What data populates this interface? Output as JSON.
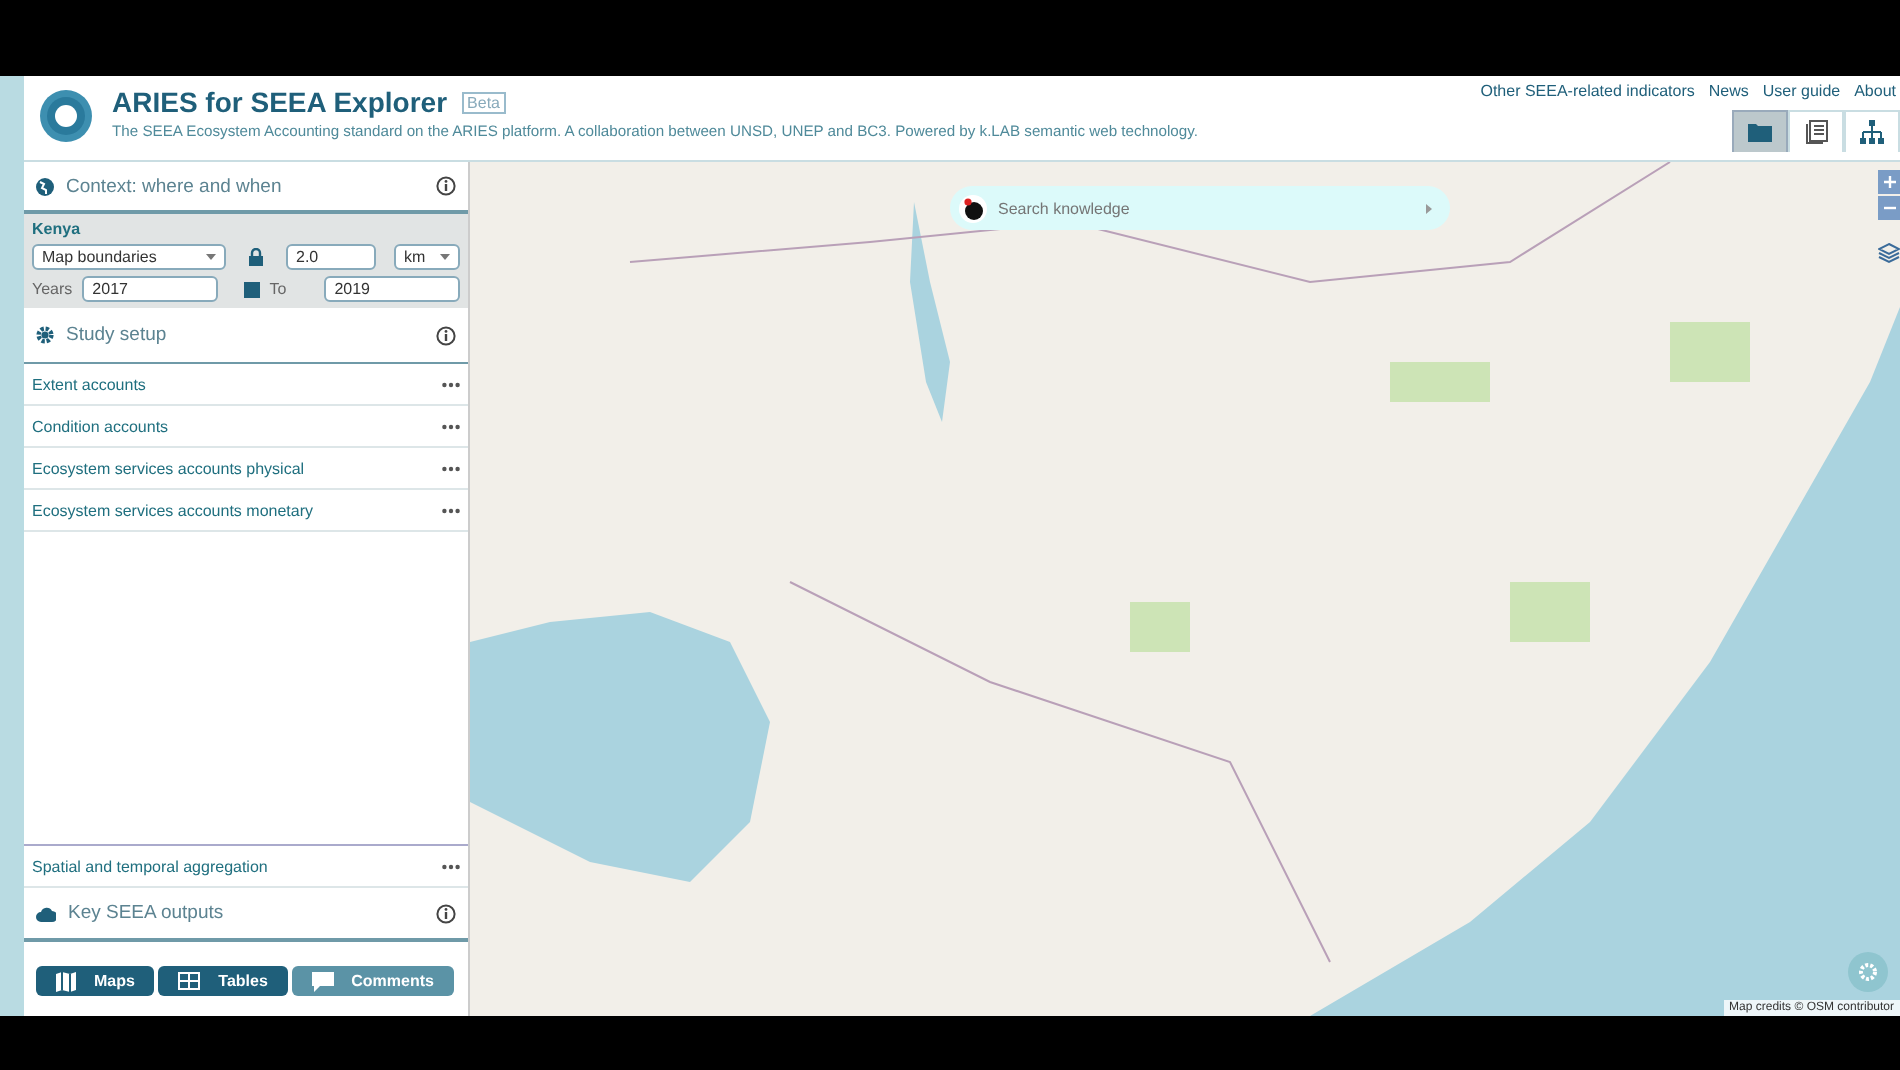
{
  "header": {
    "title": "ARIES for SEEA Explorer",
    "badge": "Beta",
    "subtitle": "The SEEA Ecosystem Accounting standard on the ARIES platform. A collaboration between UNSD, UNEP and BC3. Powered by k.LAB semantic web technology.",
    "links": [
      "Other SEEA-related indicators",
      "News",
      "User guide",
      "About"
    ],
    "view_tabs": [
      {
        "kind": "folder",
        "selected": true
      },
      {
        "kind": "document",
        "selected": false
      },
      {
        "kind": "hierarchy",
        "selected": false
      }
    ]
  },
  "sidebar": {
    "context": {
      "title": "Context: where and when",
      "region": "Kenya",
      "boundary": "Map boundaries",
      "resolution": "2.0",
      "unit": "km",
      "years_label": "Years",
      "start_year": "2017",
      "range_checked": true,
      "to_label": "To",
      "end_year": "2019"
    },
    "study_setup": {
      "title": "Study setup",
      "items": [
        "Extent accounts",
        "Condition accounts",
        "Ecosystem services accounts physical",
        "Ecosystem services accounts monetary"
      ]
    },
    "aggregation": "Spatial and temporal aggregation",
    "outputs_title": "Key SEEA outputs",
    "buttons": [
      {
        "label": "Maps",
        "kind": "map",
        "disabled": false
      },
      {
        "label": "Tables",
        "kind": "table",
        "disabled": false
      },
      {
        "label": "Comments",
        "kind": "comment",
        "disabled": true
      }
    ]
  },
  "map": {
    "search_placeholder": "Search knowledge",
    "credits": "Map credits © OSM contributor"
  }
}
